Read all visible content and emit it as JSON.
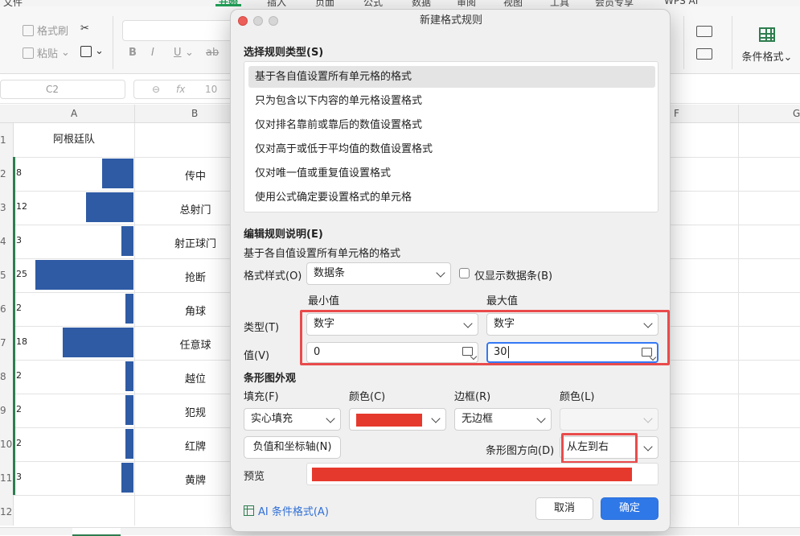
{
  "app": {
    "menu_tabs": [
      "文件",
      "开始",
      "插入",
      "页面",
      "公式",
      "数据",
      "审阅",
      "视图",
      "工具",
      "会员专享",
      "WPS AI"
    ],
    "active_tab": "开始",
    "ribbon": {
      "format_painter": "格式刷",
      "paste": "粘贴",
      "conditional_format": "条件格式"
    },
    "name_box": "C2",
    "formula_value": "10"
  },
  "sheet": {
    "columns": [
      "A",
      "B",
      "F",
      "G"
    ],
    "row_numbers": [
      "1",
      "2",
      "3",
      "4",
      "5",
      "6",
      "7",
      "8",
      "9",
      "10",
      "11",
      "12"
    ],
    "header_a": "阿根廷队",
    "rows": [
      {
        "value": "8",
        "fraction": 0.32,
        "name": "传中"
      },
      {
        "value": "12",
        "fraction": 0.48,
        "name": "总射门"
      },
      {
        "value": "3",
        "fraction": 0.12,
        "name": "射正球门"
      },
      {
        "value": "25",
        "fraction": 1.0,
        "name": "抢断"
      },
      {
        "value": "2",
        "fraction": 0.08,
        "name": "角球"
      },
      {
        "value": "18",
        "fraction": 0.72,
        "name": "任意球"
      },
      {
        "value": "2",
        "fraction": 0.08,
        "name": "越位"
      },
      {
        "value": "2",
        "fraction": 0.08,
        "name": "犯规"
      },
      {
        "value": "2",
        "fraction": 0.08,
        "name": "红牌"
      },
      {
        "value": "3",
        "fraction": 0.12,
        "name": "黄牌"
      }
    ],
    "bar_color": "#2f5ba4"
  },
  "dialog": {
    "title": "新建格式规则",
    "select_type_title": "选择规则类型(S)",
    "rule_types": [
      "基于各自值设置所有单元格的格式",
      "只为包含以下内容的单元格设置格式",
      "仅对排名靠前或靠后的数值设置格式",
      "仅对高于或低于平均值的数值设置格式",
      "仅对唯一值或重复值设置格式",
      "使用公式确定要设置格式的单元格"
    ],
    "edit_title": "编辑规则说明(E)",
    "edit_subtitle": "基于各自值设置所有单元格的格式",
    "format_style_label": "格式样式(O)",
    "format_style_value": "数据条",
    "only_bar_label": "仅显示数据条(B)",
    "min_label": "最小值",
    "max_label": "最大值",
    "type_label": "类型(T)",
    "min_type": "数字",
    "max_type": "数字",
    "value_label": "值(V)",
    "min_value": "0",
    "max_value": "30",
    "bar_appearance_title": "条形图外观",
    "fill_label": "填充(F)",
    "fill_value": "实心填充",
    "color_label": "颜色(C)",
    "fill_color": "#e6392d",
    "border_label": "边框(R)",
    "border_value": "无边框",
    "border_color_label": "颜色(L)",
    "negative_axis_btn": "负值和坐标轴(N)",
    "direction_label": "条形图方向(D)",
    "direction_value": "从左到右",
    "preview_label": "预览",
    "ai_link": "AI 条件格式(A)",
    "cancel": "取消",
    "ok": "确定",
    "highlight_color": "#e94b4b",
    "accent_color": "#2f78e8"
  }
}
